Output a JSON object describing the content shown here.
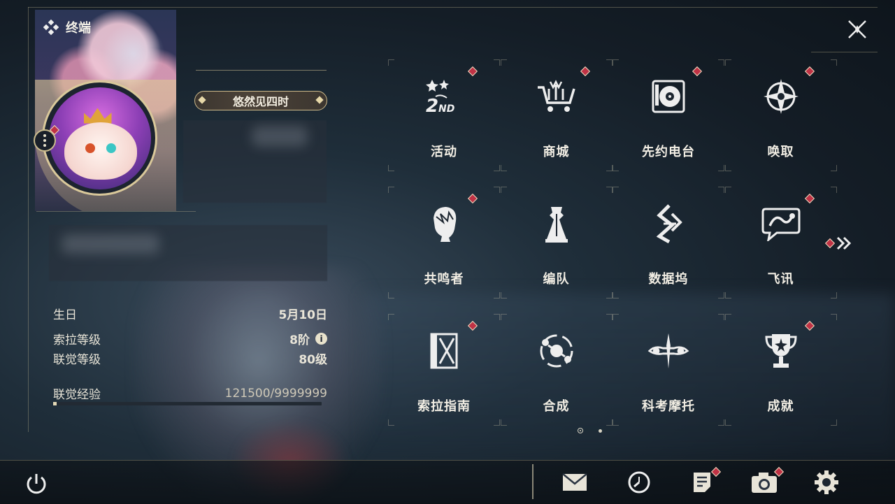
{
  "header": {
    "title": "终端"
  },
  "profile": {
    "name_plate": "悠然见四时",
    "info": [
      {
        "label": "生日",
        "value": "5月10日"
      },
      {
        "label": "索拉等级",
        "value": "8阶"
      },
      {
        "label": "联觉等级",
        "value": "80级"
      },
      {
        "label": "联觉经验",
        "value": "121500/9999999"
      }
    ],
    "exp_progress": 0.0122
  },
  "menu": {
    "items": [
      {
        "label": "活动",
        "icon": "2nd-anniversary-icon",
        "badge": true
      },
      {
        "label": "商城",
        "icon": "shop-cart-icon",
        "badge": true
      },
      {
        "label": "先约电台",
        "icon": "radio-record-icon",
        "badge": true
      },
      {
        "label": "唤取",
        "icon": "convene-star-icon",
        "badge": true
      },
      {
        "label": "共鸣者",
        "icon": "resonator-portrait-icon",
        "badge": true
      },
      {
        "label": "编队",
        "icon": "team-chess-icon",
        "badge": false
      },
      {
        "label": "数据坞",
        "icon": "data-dock-icon",
        "badge": false
      },
      {
        "label": "飞讯",
        "icon": "message-bubble-icon",
        "badge": true
      },
      {
        "label": "索拉指南",
        "icon": "guide-book-icon",
        "badge": true
      },
      {
        "label": "合成",
        "icon": "synthesis-orbit-icon",
        "badge": false
      },
      {
        "label": "科考摩托",
        "icon": "motorbike-icon",
        "badge": false
      },
      {
        "label": "成就",
        "icon": "trophy-icon",
        "badge": true
      }
    ],
    "page_dots": {
      "total": 2,
      "current": 1
    }
  },
  "bottom_bar": {
    "buttons": [
      {
        "name": "mail",
        "icon": "mail-icon",
        "badge": false
      },
      {
        "name": "history",
        "icon": "clock-icon",
        "badge": false
      },
      {
        "name": "notes",
        "icon": "notice-icon",
        "badge": true
      },
      {
        "name": "camera",
        "icon": "camera-icon",
        "badge": true
      },
      {
        "name": "settings",
        "icon": "gear-icon",
        "badge": false
      }
    ]
  },
  "colors": {
    "accent_gold": "#d9c89a",
    "badge_red": "#c03245",
    "text": "#f2eee4"
  }
}
